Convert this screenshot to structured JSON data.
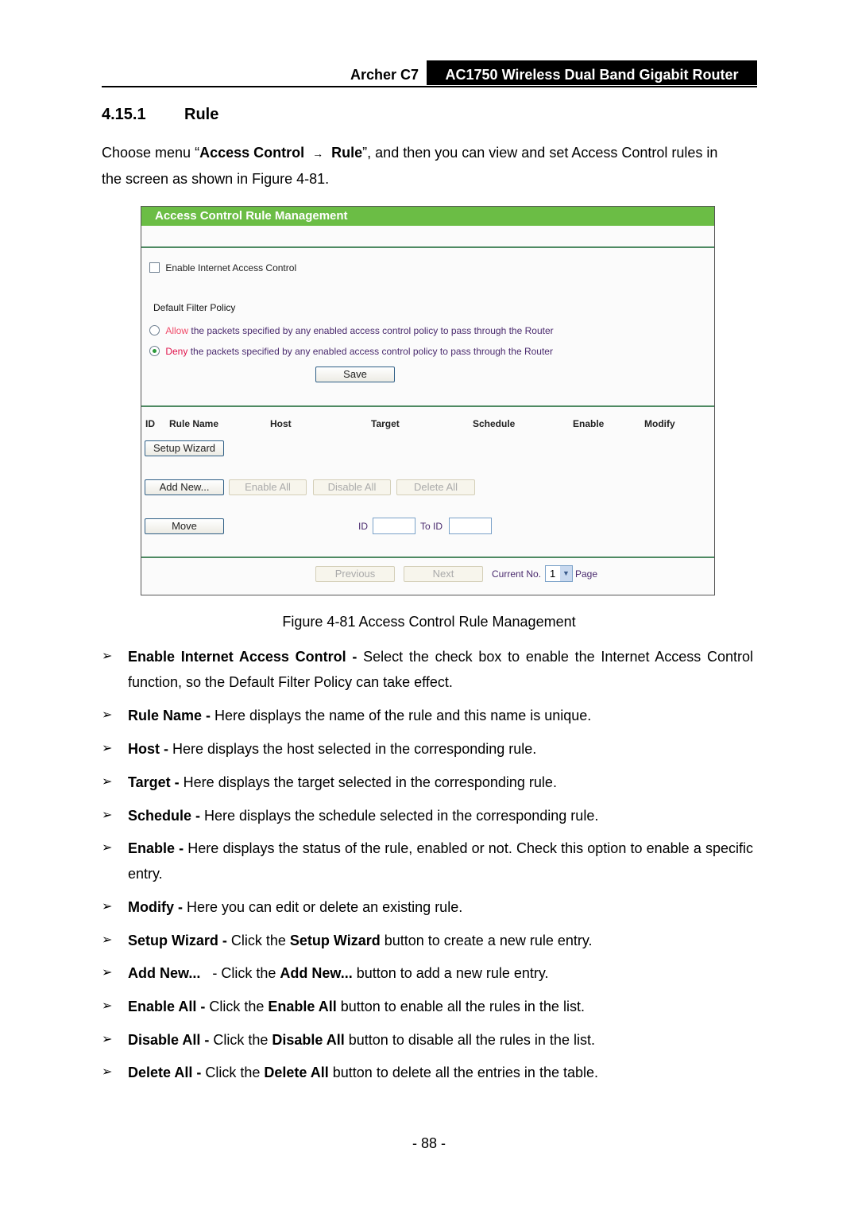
{
  "header": {
    "model": "Archer C7",
    "product": "AC1750 Wireless Dual Band Gigabit Router"
  },
  "section": {
    "number": "4.15.1",
    "title": "Rule"
  },
  "intro": {
    "p1": "Choose menu “",
    "b1": "Access Control",
    "arrow": "→",
    "b2": "Rule",
    "p2": "”, and then you can view and set Access Control rules in",
    "line2": "the screen as shown in Figure 4-81."
  },
  "figure": {
    "title": "Access Control Rule Management",
    "enable_checkbox": {
      "label": "Enable Internet Access Control",
      "checked": false
    },
    "policy_heading": "Default Filter Policy",
    "policy_options": [
      {
        "keyword": "Allow",
        "rest": " the packets specified by any enabled access control policy to pass through the Router",
        "selected": false
      },
      {
        "keyword": "Deny",
        "rest": " the packets specified by any enabled access control policy to pass through the Router",
        "selected": true
      }
    ],
    "save_label": "Save",
    "columns": [
      "ID",
      "Rule Name",
      "Host",
      "Target",
      "Schedule",
      "Enable",
      "Modify"
    ],
    "setup_wizard_label": "Setup Wizard",
    "add_new_label": "Add New...",
    "enable_all_label": "Enable All",
    "disable_all_label": "Disable All",
    "delete_all_label": "Delete All",
    "move_label": "Move",
    "id_label": "ID",
    "id_value": "",
    "to_id_label": "To ID",
    "to_id_value": "",
    "previous_label": "Previous",
    "next_label": "Next",
    "current_no_label": "Current No.",
    "current_page": "1",
    "page_label": "Page"
  },
  "caption": "Figure 4-81 Access Control Rule Management",
  "bullets": [
    {
      "term": "Enable Internet Access Control -",
      "text": " Select the check box to enable the Internet Access Control function, so the Default Filter Policy can take effect."
    },
    {
      "term": "Rule Name -",
      "text": " Here displays the name of the rule and this name is unique."
    },
    {
      "term": "Host -",
      "text": " Here displays the host selected in the corresponding rule."
    },
    {
      "term": "Target -",
      "text": " Here displays the target selected in the corresponding rule."
    },
    {
      "term": "Schedule -",
      "text": " Here displays the schedule selected in the corresponding rule."
    },
    {
      "term": "Enable -",
      "text": " Here displays the status of the rule, enabled or not. Check this option to enable a specific entry."
    },
    {
      "term": "Modify -",
      "text": " Here you can edit or delete an existing rule."
    },
    {
      "term": "Setup Wizard -",
      "text": " Click the ",
      "term2": "Setup Wizard",
      "text2": " button to create a new rule entry."
    },
    {
      "term": "Add New...",
      "text": "   - Click the ",
      "term2": "Add New...",
      "text2": " button to add a new rule entry."
    },
    {
      "term": "Enable All -",
      "text": " Click the ",
      "term2": "Enable All",
      "text2": " button to enable all the rules in the list."
    },
    {
      "term": "Disable All -",
      "text": " Click the ",
      "term2": "Disable All",
      "text2": " button to disable all the rules in the list."
    },
    {
      "term": "Delete All -",
      "text": " Click the ",
      "term2": "Delete All",
      "text2": " button to delete all the entries in the table."
    }
  ],
  "bullet_marker": "➢",
  "page_number": "- 88 -",
  "colors": {
    "title_bar": "#6bbd45",
    "divider": "#4e8a62",
    "allow": "#f04c6a",
    "deny": "#e0144c"
  }
}
